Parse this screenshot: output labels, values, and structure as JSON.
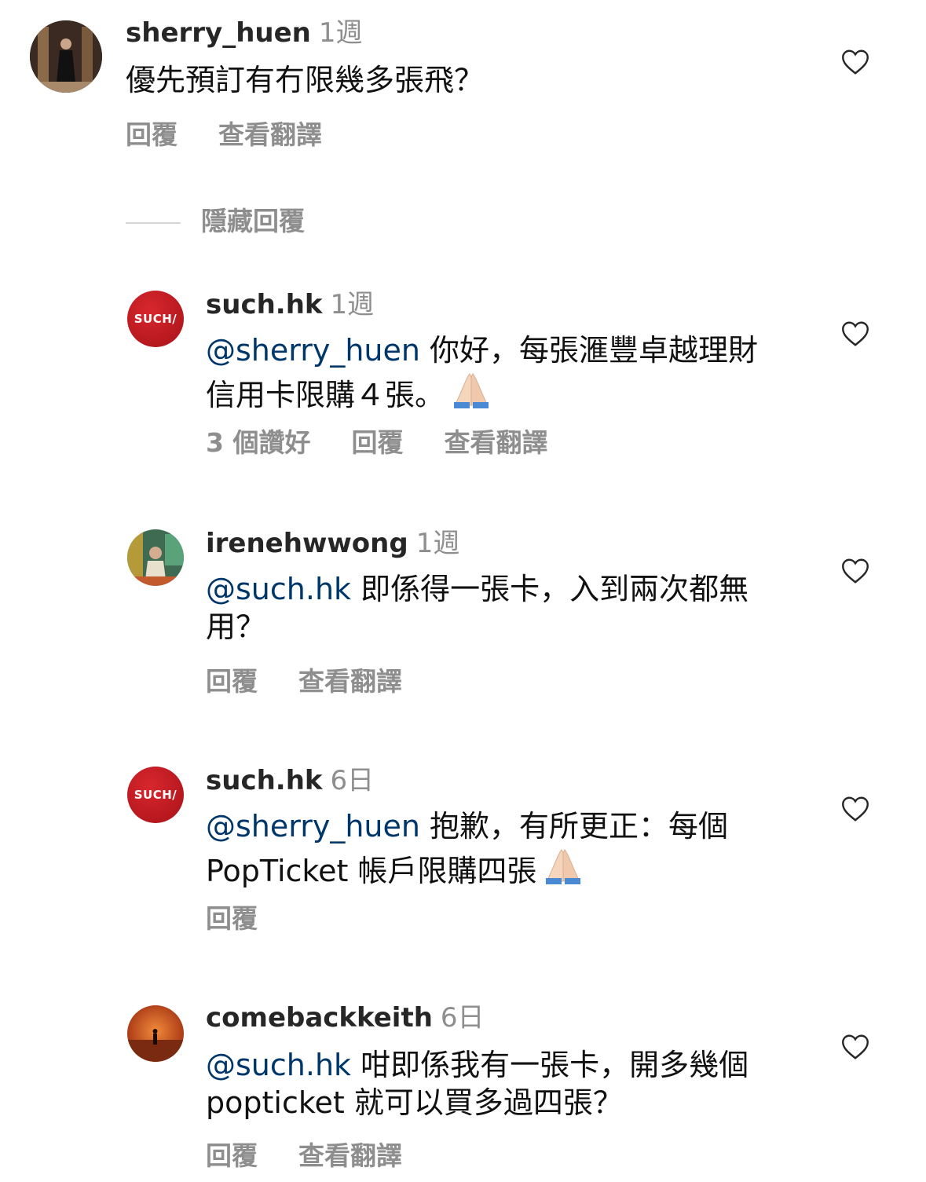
{
  "comments": [
    {
      "username": "sherry_huen",
      "time": "1週",
      "mention": "",
      "text": "優先預訂有冇限幾多張飛？",
      "likes": "",
      "reply": "回覆",
      "translate": "查看翻譯"
    },
    {
      "username": "such.hk",
      "time": "1週",
      "mention": "@sherry_huen",
      "text": " 你好，每張滙豐卓越理財信用卡限購４張。",
      "likes": "3 個讚好",
      "reply": "回覆",
      "translate": "查看翻譯",
      "logo": "SUCH/"
    },
    {
      "username": "irenehwwong",
      "time": "1週",
      "mention": "@such.hk",
      "text": " 即係得一張卡，入到兩次都無用？",
      "likes": "",
      "reply": "回覆",
      "translate": "查看翻譯"
    },
    {
      "username": "such.hk",
      "time": "6日",
      "mention": "@sherry_huen",
      "text": " 抱歉，有所更正：每個PopTicket 帳戶限購四張",
      "likes": "",
      "reply": "回覆",
      "translate": "",
      "logo": "SUCH/"
    },
    {
      "username": "comebackkeith",
      "time": "6日",
      "mention": "@such.hk",
      "text": " 咁即係我有一張卡，開多幾個 popticket 就可以買多過四張？",
      "likes": "",
      "reply": "回覆",
      "translate": "查看翻譯"
    }
  ],
  "hide_replies": "隱藏回覆",
  "icons": {
    "like": "heart-outline-icon",
    "pray": "folded-hands-emoji"
  },
  "colors": {
    "mention": "#00376b",
    "muted": "#8e8e8e",
    "logo": "#c41a20"
  }
}
